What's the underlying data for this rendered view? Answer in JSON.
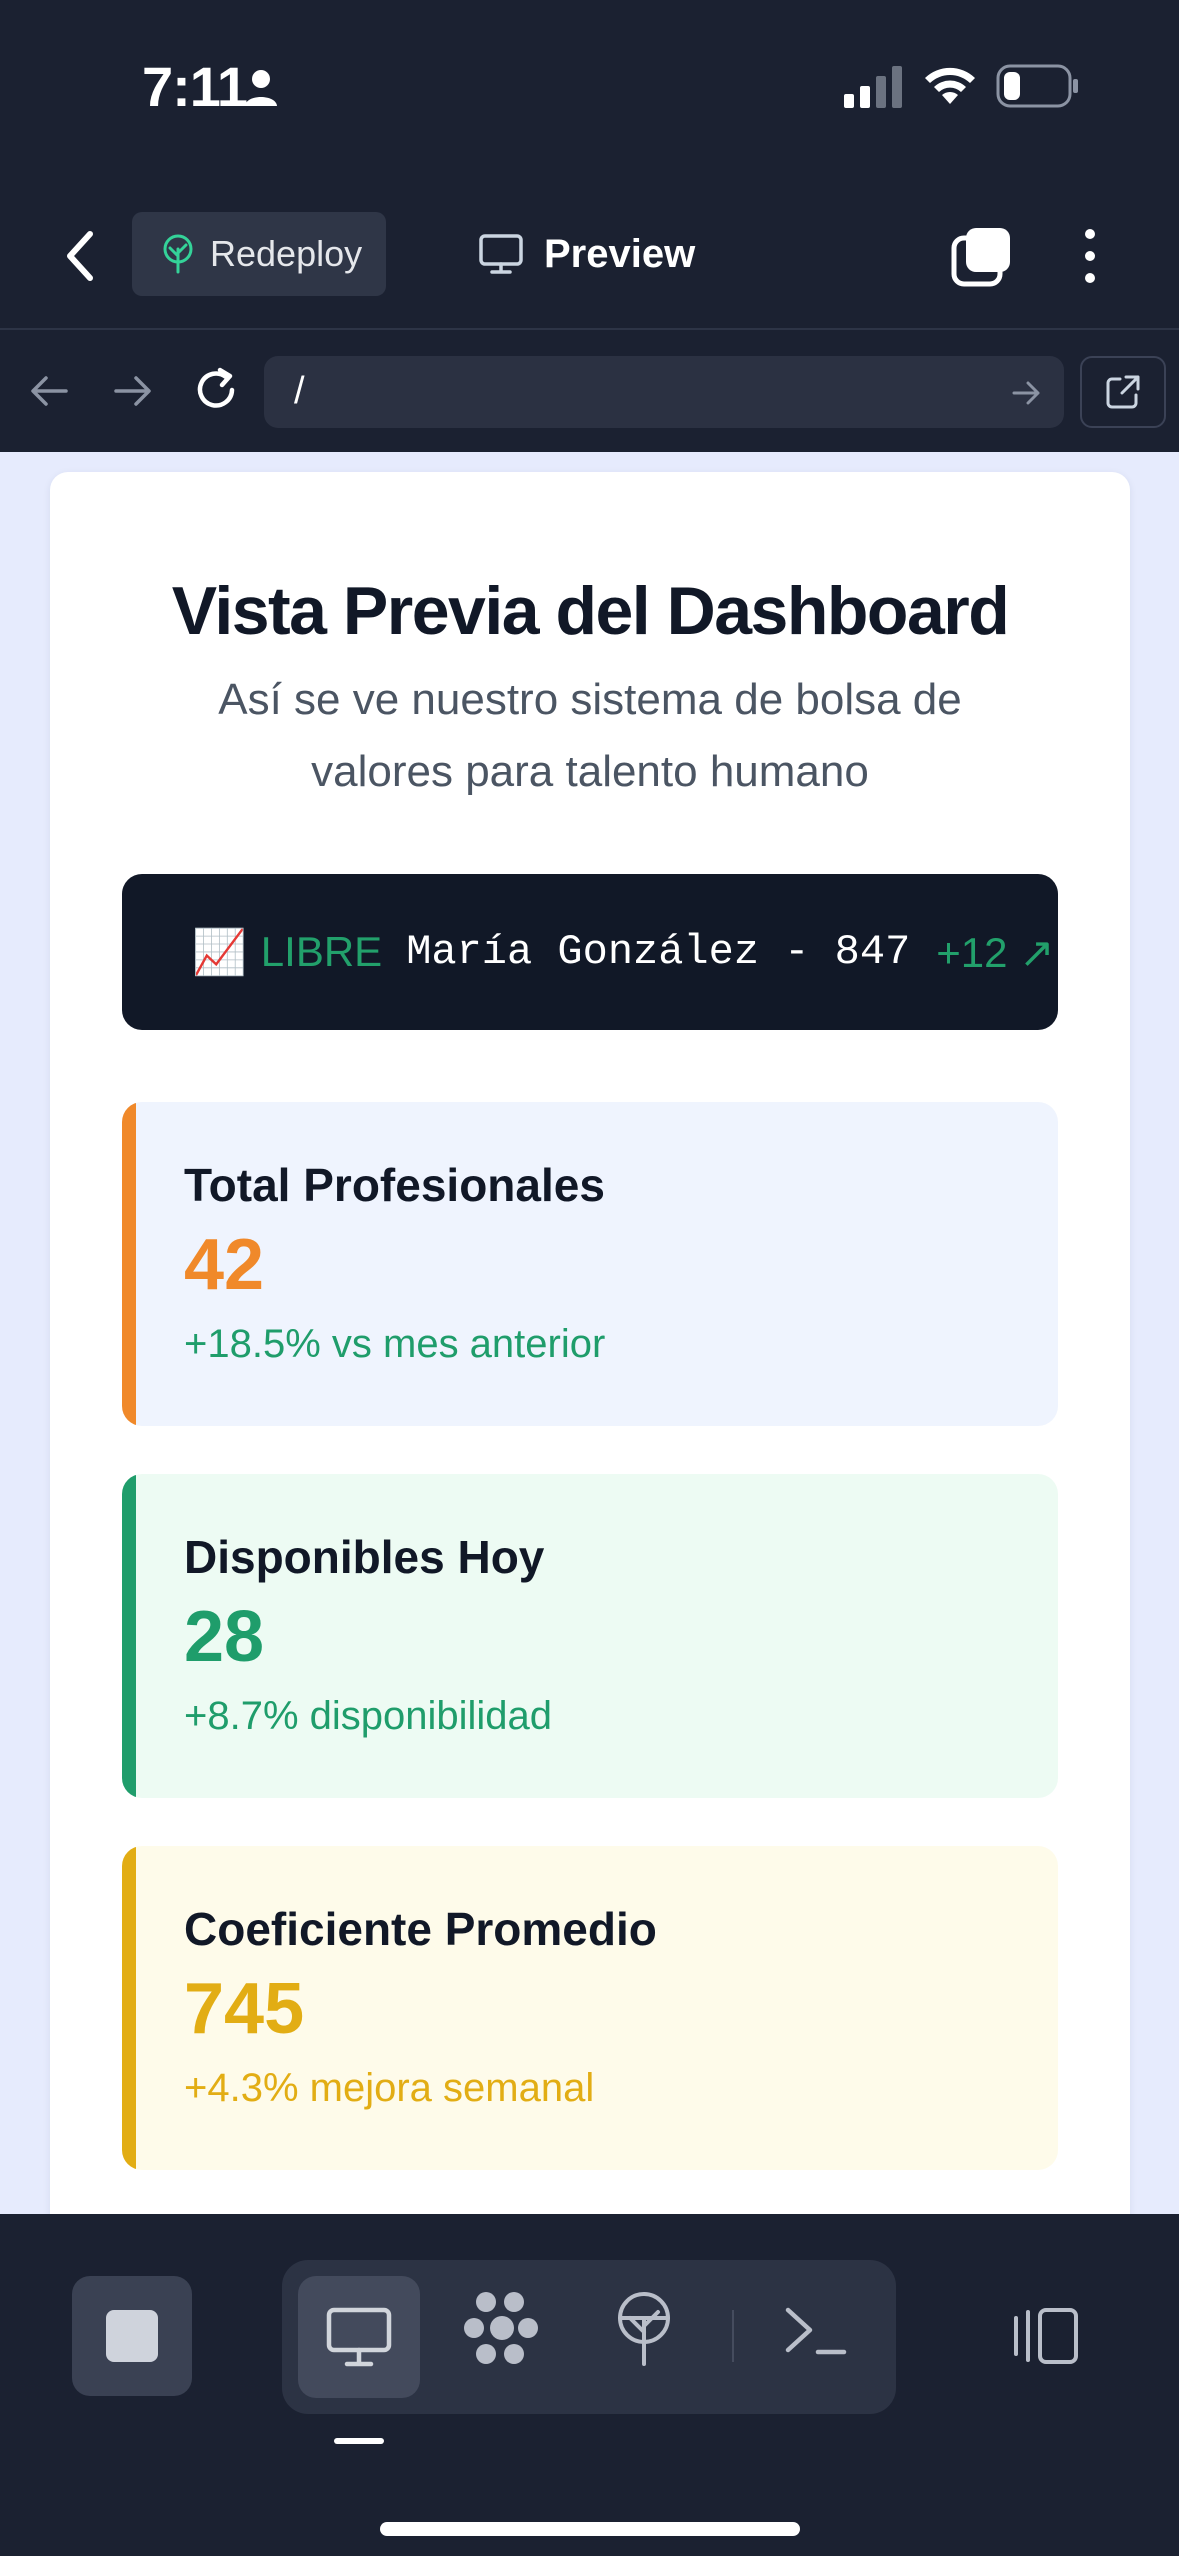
{
  "status_bar": {
    "time": "7:11",
    "icons": [
      "person-icon",
      "cellular-signal-icon",
      "wifi-icon",
      "battery-icon"
    ]
  },
  "header": {
    "back_icon": "chevron-left-icon",
    "redeploy_label": "Redeploy",
    "redeploy_icon": "deploy-tree-icon",
    "preview_label": "Preview",
    "preview_icon": "monitor-icon",
    "tabs_icon": "tabs-icon",
    "more_icon": "more-vertical-icon"
  },
  "url_bar": {
    "url": "/",
    "icons": [
      "arrow-left-icon",
      "arrow-right-icon",
      "reload-icon",
      "go-arrow-icon",
      "external-link-icon"
    ]
  },
  "page": {
    "title": "Vista Previa del Dashboard",
    "subtitle": "Así se ve nuestro sistema de bolsa de valores para talento humano",
    "ticker": {
      "icon": "📈",
      "status": "LIBRE",
      "entry": "María González - 847",
      "change": "+12 ↗"
    },
    "stats": [
      {
        "label": "Total Profesionales",
        "value": "42",
        "trend": "+18.5% vs mes anterior",
        "accent": "#f0892a"
      },
      {
        "label": "Disponibles Hoy",
        "value": "28",
        "trend": "+8.7% disponibilidad",
        "accent": "#1f9d6b"
      },
      {
        "label": "Coeficiente Promedio",
        "value": "745",
        "trend": "+4.3% mejora semanal",
        "accent": "#e2ad14"
      }
    ]
  },
  "toolbar": {
    "icons": [
      "stop-icon",
      "monitor-icon",
      "agent-icon",
      "deploy-icon",
      "terminal-icon",
      "layout-panel-icon"
    ],
    "active": "preview"
  },
  "colors": {
    "chrome_bg": "#1b2131",
    "web_bg": "#e6ebfd",
    "success": "#1f9d6b"
  }
}
